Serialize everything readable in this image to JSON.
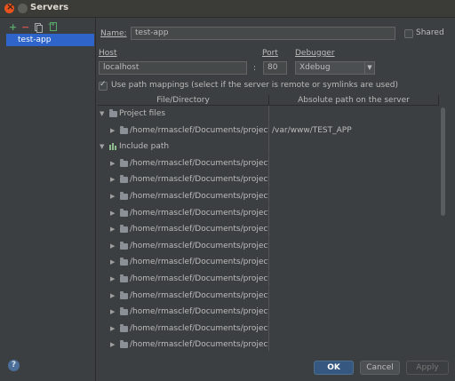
{
  "window": {
    "title": "Servers"
  },
  "sidebar": {
    "toolbar": {
      "add": "+",
      "remove": "−"
    },
    "items": [
      {
        "label": "test-app"
      }
    ]
  },
  "form": {
    "name_label": "Name:",
    "name_value": "test-app",
    "shared_label": "Shared",
    "shared_checked": false,
    "host_label": "Host",
    "host_value": "localhost",
    "colon": ":",
    "port_label": "Port",
    "port_value": "80",
    "debugger_label": "Debugger",
    "debugger_value": "Xdebug",
    "path_mappings_label": "Use path mappings (select if the server is remote or symlinks are used)",
    "path_mappings_checked": true
  },
  "table": {
    "headers": [
      "File/Directory",
      "Absolute path on the server"
    ],
    "rows": [
      {
        "type": "group",
        "label": "Project files"
      },
      {
        "type": "item",
        "label": "/home/rmasclef/Documents/projects",
        "server": "/var/www/TEST_APP"
      },
      {
        "type": "group-lib",
        "label": "Include path"
      },
      {
        "type": "item",
        "label": "/home/rmasclef/Documents/projects",
        "server": ""
      },
      {
        "type": "item",
        "label": "/home/rmasclef/Documents/projects",
        "server": ""
      },
      {
        "type": "item",
        "label": "/home/rmasclef/Documents/projects",
        "server": ""
      },
      {
        "type": "item",
        "label": "/home/rmasclef/Documents/projects",
        "server": ""
      },
      {
        "type": "item",
        "label": "/home/rmasclef/Documents/projects",
        "server": ""
      },
      {
        "type": "item",
        "label": "/home/rmasclef/Documents/projects",
        "server": ""
      },
      {
        "type": "item",
        "label": "/home/rmasclef/Documents/projects",
        "server": ""
      },
      {
        "type": "item",
        "label": "/home/rmasclef/Documents/projects",
        "server": ""
      },
      {
        "type": "item",
        "label": "/home/rmasclef/Documents/projects",
        "server": ""
      },
      {
        "type": "item",
        "label": "/home/rmasclef/Documents/projects",
        "server": ""
      },
      {
        "type": "item",
        "label": "/home/rmasclef/Documents/projects",
        "server": ""
      },
      {
        "type": "item",
        "label": "/home/rmasclef/Documents/projects",
        "server": ""
      }
    ]
  },
  "buttons": {
    "ok": "OK",
    "cancel": "Cancel",
    "apply": "Apply",
    "help": "?"
  }
}
